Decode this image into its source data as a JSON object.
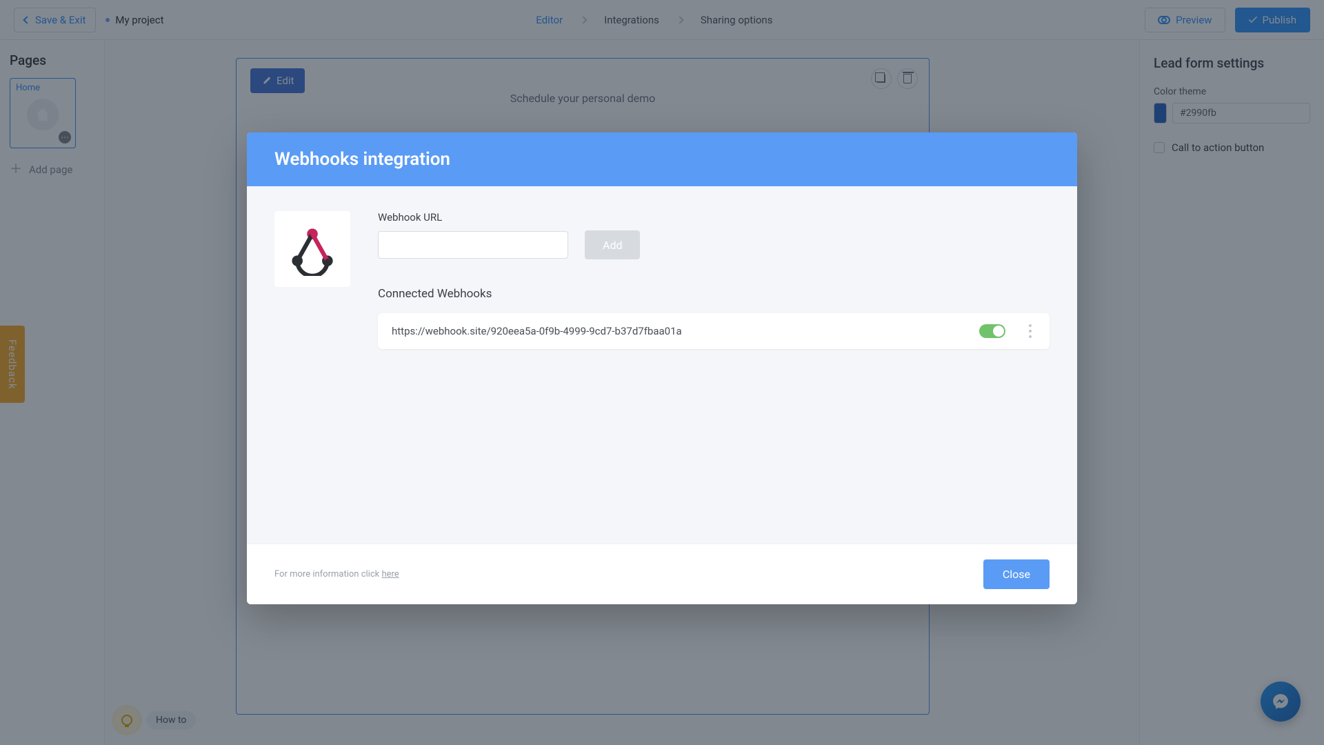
{
  "topbar": {
    "save_exit": "Save & Exit",
    "project_name": "My project",
    "steps": [
      "Editor",
      "Integrations",
      "Sharing options"
    ],
    "preview": "Preview",
    "publish": "Publish"
  },
  "left": {
    "title": "Pages",
    "page_card_label": "Home",
    "add_page": "Add page"
  },
  "canvas": {
    "edit": "Edit",
    "form_title": "Schedule your personal demo",
    "howto": "How to"
  },
  "right": {
    "title": "Lead form settings",
    "color_label": "Color theme",
    "color_value": "#2990fb",
    "cta_label": "Call to action button"
  },
  "feedback": "Feedback",
  "modal": {
    "title": "Webhooks integration",
    "url_label": "Webhook URL",
    "add": "Add",
    "connected_title": "Connected Webhooks",
    "items": [
      {
        "url": "https://webhook.site/920eea5a-0f9b-4999-9cd7-b37d7fbaa01a",
        "enabled": true
      }
    ],
    "footer_info_prefix": "For more information click ",
    "footer_info_link": "here",
    "close": "Close"
  }
}
